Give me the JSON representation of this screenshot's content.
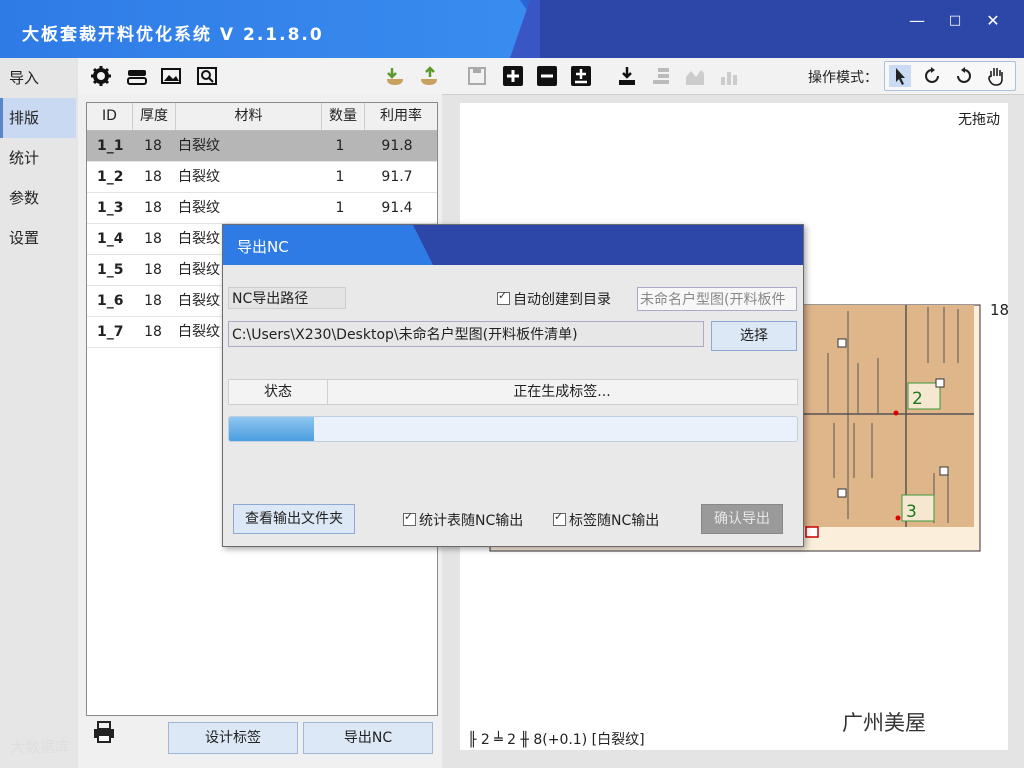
{
  "app": {
    "title": "大板套裁开料优化系统 V 2.1.8.0",
    "window_minimize": "—",
    "window_maximize": "□",
    "window_close": "✕"
  },
  "nav": {
    "items": [
      {
        "label": "导入",
        "active": false
      },
      {
        "label": "排版",
        "active": true
      },
      {
        "label": "统计",
        "active": false
      },
      {
        "label": "参数",
        "active": false
      },
      {
        "label": "设置",
        "active": false
      }
    ]
  },
  "toolbar": {
    "mode_label": "操作模式：",
    "icons": [
      "gear-icon",
      "layers-icon",
      "image-icon",
      "scan-icon",
      "import-left-icon",
      "import-right-icon",
      "save-icon",
      "add-icon",
      "remove-icon",
      "add-sheet-icon",
      "download-icon",
      "stack-icon",
      "chart-icon",
      "chart-alt-icon"
    ],
    "modes": [
      "pointer-icon",
      "rotate-icon",
      "refresh-icon",
      "hand-icon"
    ]
  },
  "table": {
    "headers": [
      "ID",
      "厚度",
      "材料",
      "数量",
      "利用率"
    ],
    "rows": [
      {
        "id": "1_1",
        "thickness": "18",
        "material": "白裂纹",
        "qty": "1",
        "util": "91.8",
        "selected": true
      },
      {
        "id": "1_2",
        "thickness": "18",
        "material": "白裂纹",
        "qty": "1",
        "util": "91.7",
        "selected": false
      },
      {
        "id": "1_3",
        "thickness": "18",
        "material": "白裂纹",
        "qty": "1",
        "util": "91.4",
        "selected": false
      },
      {
        "id": "1_4",
        "thickness": "18",
        "material": "白裂纹",
        "qty": "",
        "util": "",
        "selected": false
      },
      {
        "id": "1_5",
        "thickness": "18",
        "material": "白裂纹",
        "qty": "",
        "util": "",
        "selected": false
      },
      {
        "id": "1_6",
        "thickness": "18",
        "material": "白裂纹",
        "qty": "",
        "util": "",
        "selected": false
      },
      {
        "id": "1_7",
        "thickness": "18",
        "material": "白裂纹",
        "qty": "",
        "util": "",
        "selected": false
      }
    ]
  },
  "left_buttons": {
    "design_label": "设计标签",
    "export_nc": "导出NC"
  },
  "canvas": {
    "drag_status": "无拖动",
    "sheet_count": "18",
    "part_labels": [
      "2",
      "3"
    ],
    "status": "╟ 2 ╧ 2   ╫ 8(+0.1)    [白裂纹]",
    "watermark": "广州美屋",
    "corner_watermark": "大数据库"
  },
  "dialog": {
    "title": "导出NC",
    "path_label": "NC导出路径",
    "auto_create_label": "自动创建到目录",
    "folder_name": "未命名户型图(开料板件",
    "path_value": "C:\\Users\\X230\\Desktop\\未命名户型图(开料板件清单)",
    "select_button": "选择",
    "status_label": "状态",
    "status_value": "正在生成标签...",
    "progress": 0.15,
    "view_folder_button": "查看输出文件夹",
    "stats_with_nc": "统计表随NC输出",
    "labels_with_nc": "标签随NC输出",
    "confirm_button": "确认导出"
  },
  "colors": {
    "title_blue": "#2f7be6",
    "dark_blue": "#2c47a8",
    "board": "#dfb58a",
    "selected_row": "#b6b6b6"
  }
}
